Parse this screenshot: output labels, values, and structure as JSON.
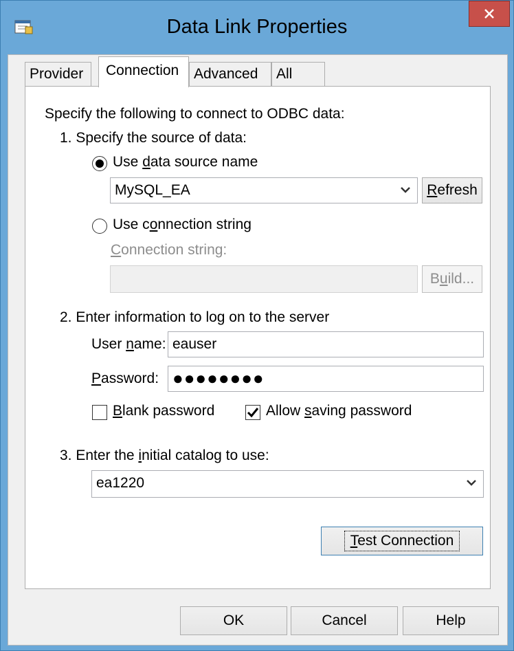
{
  "window": {
    "title": "Data Link Properties"
  },
  "tabs": [
    {
      "label": "Provider"
    },
    {
      "label": "Connection"
    },
    {
      "label": "Advanced"
    },
    {
      "label": "All"
    }
  ],
  "connection": {
    "intro": "Specify the following to connect to ODBC data:",
    "step1": "1. Specify the source of data:",
    "use_dsn_label": "Use data source name",
    "use_dsn_checked": true,
    "dsn_value": "MySQL_EA",
    "refresh_label": "Refresh",
    "use_conn_string_label": "Use connection string",
    "conn_string_label": "Connection string:",
    "conn_string_value": "",
    "build_label": "Build...",
    "step2": "2. Enter information to log on to the server",
    "username_label": "User name:",
    "username_value": "eauser",
    "password_label": "Password:",
    "password_mask": "●●●●●●●●",
    "blank_password_label": "Blank password",
    "blank_password_checked": false,
    "allow_saving_label": "Allow saving password",
    "allow_saving_checked": true,
    "step3": "3. Enter the initial catalog to use:",
    "catalog_value": "ea1220",
    "test_connection_label": "Test Connection"
  },
  "footer": {
    "ok_label": "OK",
    "cancel_label": "Cancel",
    "help_label": "Help"
  }
}
